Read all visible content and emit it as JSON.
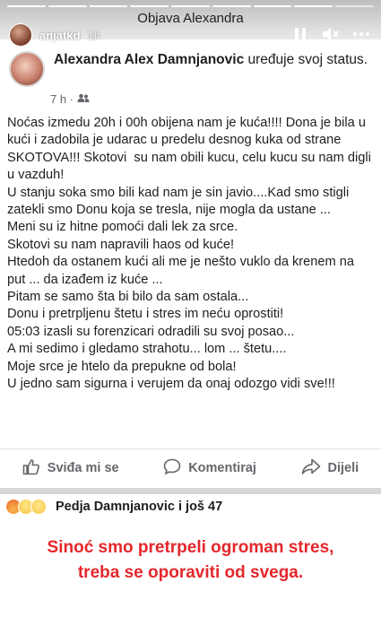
{
  "story": {
    "progress_segments": 9,
    "progress_done": 8,
    "header_title": "Objava Alexandra",
    "username": "anjatkd",
    "time": "1h",
    "pause_icon": "pause-icon",
    "mute_icon": "mute-icon",
    "more_icon": "more-icon"
  },
  "post": {
    "author_name": "Alexandra Alex Damnjanovic",
    "author_action": " uređuje svoj status.",
    "time": "7 h ·",
    "audience_icon": "friends-icon",
    "body": "Noćas izmedu 20h i 00h obijena nam je kuća!!!! Dona je bila u kući i zadobila je udarac u predelu desnog kuka od strane SKOTOVA!!! Skotovi  su nam obili kucu, celu kucu su nam digli u vazduh!\nU stanju soka smo bili kad nam je sin javio....Kad smo stigli zatekli smo Donu koja se tresla, nije mogla da ustane ...\nMeni su iz hitne pomoći dali lek za srce.\nSkotovi su nam napravili haos od kuće!\nHtedoh da ostanem kući ali me je nešto vuklo da krenem na put ... da izađem iz kuće ...\nPitam se samo šta bi bilo da sam ostala...\nDonu i pretrpljenu štetu i stres im neću oprostiti!\n05:03 izasli su forenzicari odradili su svoj posao...\nA mi sedimo i gledamo strahotu... lom ... štetu....\nMoje srce je htelo da prepukne od bola!\nU jedno sam sigurna i verujem da onaj odozgo vidi sve!!!"
  },
  "actions": {
    "like": "Sviđa mi se",
    "comment": "Komentiraj",
    "share": "Dijeli"
  },
  "reactions": {
    "text": "Pedja Damnjanovic i još 47",
    "emojis": [
      "angry",
      "sad",
      "wow"
    ],
    "colors": {
      "angry": "#f0662b",
      "sad": "#f7c645",
      "wow": "#f7c645"
    }
  },
  "caption": {
    "line1": "Sinoć smo pretrpeli ogroman stres,",
    "line2": "treba se oporaviti od svega."
  }
}
